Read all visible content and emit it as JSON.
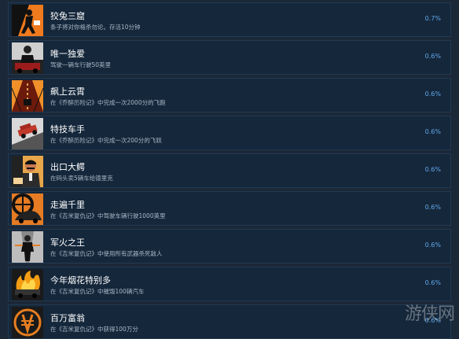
{
  "achievements": [
    {
      "title": "狡兔三窟",
      "desc": "条子将对你格杀勿论。存活10分钟",
      "percent": "0.7%",
      "icon": "thief-silhouette-icon"
    },
    {
      "title": "唯一独爱",
      "desc": "驾驶一辆车行驶50英里",
      "percent": "0.6%",
      "icon": "car-driver-icon"
    },
    {
      "title": "飙上云霄",
      "desc": "在《乔醉历险记》中完成一次2000分的飞跑",
      "percent": "0.6%",
      "icon": "highway-speed-icon"
    },
    {
      "title": "特技车手",
      "desc": "在《乔醉历险记》中完成一次200分的飞跃",
      "percent": "0.6%",
      "icon": "stunt-car-icon"
    },
    {
      "title": "出口大鳄",
      "desc": "在码头卖5辆车给德里克",
      "percent": "0.6%",
      "icon": "car-dealer-icon"
    },
    {
      "title": "走遍千里",
      "desc": "在《吉米复仇记》中驾驶车辆行驶1000英里",
      "percent": "0.6%",
      "icon": "wheel-car-icon"
    },
    {
      "title": "军火之王",
      "desc": "在《吉米复仇记》中使用所有武器杀死敌人",
      "percent": "0.6%",
      "icon": "gunman-icon"
    },
    {
      "title": "今年烟花特别多",
      "desc": "在《吉米复仇记》中摧毁100辆汽车",
      "percent": "0.6%",
      "icon": "burning-car-icon"
    },
    {
      "title": "百万富翁",
      "desc": "在《吉米复仇记》中获得100万分",
      "percent": "0.6%",
      "icon": "money-emblem-icon"
    }
  ],
  "watermark": "游侠网"
}
